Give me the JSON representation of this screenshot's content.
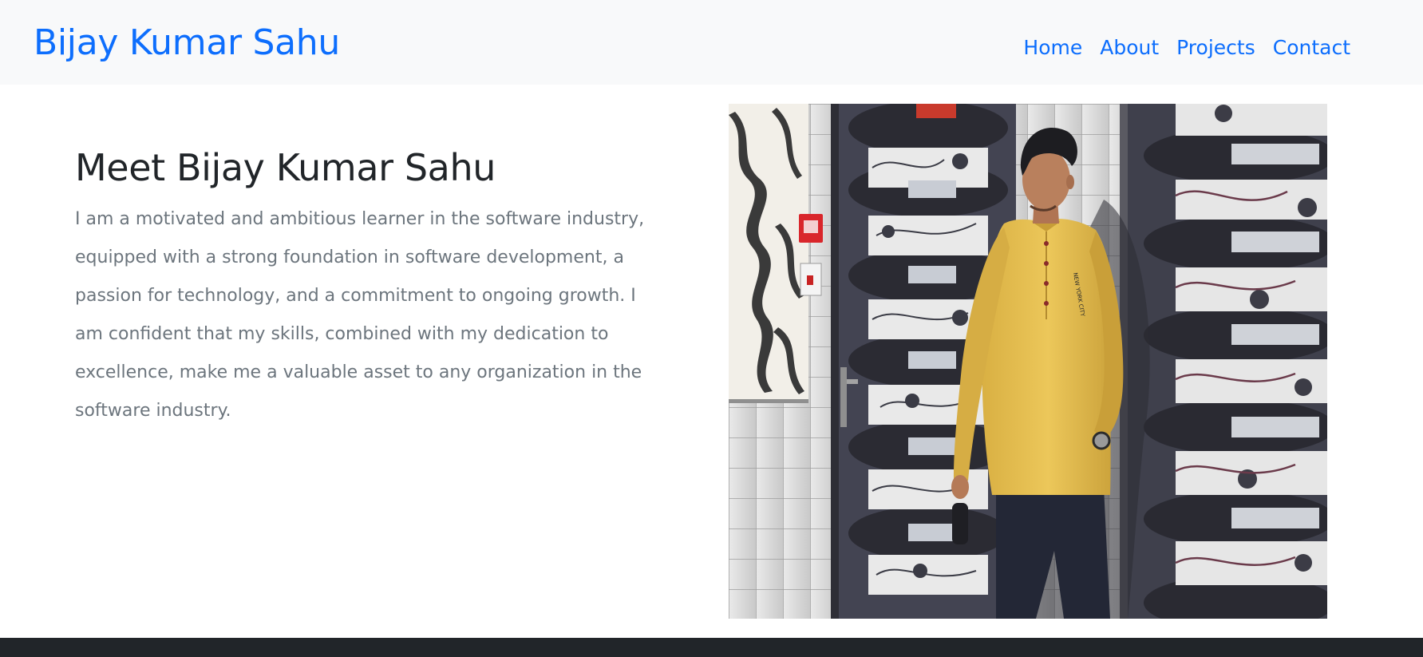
{
  "navbar": {
    "brand": "Bijay Kumar Sahu",
    "links": [
      {
        "label": "Home"
      },
      {
        "label": "About"
      },
      {
        "label": "Projects"
      },
      {
        "label": "Contact"
      }
    ]
  },
  "hero": {
    "title": "Meet Bijay Kumar Sahu",
    "body": "I am a motivated and ambitious learner in the software industry, equipped with a strong foundation in software development, a passion for technology, and a commitment to ongoing growth. I am confident that my skills, combined with my dedication to excellence, make me a valuable asset to any organization in the software industry.",
    "photo_label": "NEW YORK CITY"
  },
  "colors": {
    "link": "#0d6efd",
    "heading": "#212529",
    "muted": "#6c757d",
    "navbar_bg": "#f8f9fa",
    "footer_bg": "#212529",
    "shirt": "#e8c24e"
  }
}
